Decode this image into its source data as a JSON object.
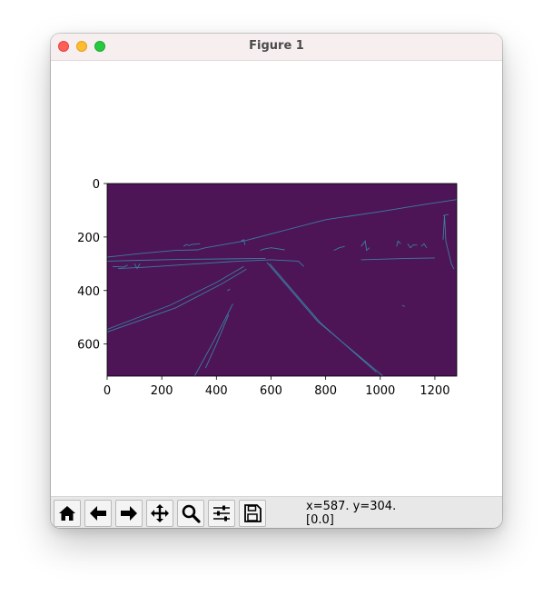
{
  "window": {
    "title": "Figure 1"
  },
  "toolbar": {
    "buttons": [
      {
        "name": "home",
        "icon": "home-icon"
      },
      {
        "name": "back",
        "icon": "arrow-left-icon"
      },
      {
        "name": "forward",
        "icon": "arrow-right-icon"
      },
      {
        "name": "pan",
        "icon": "move-icon"
      },
      {
        "name": "zoom",
        "icon": "magnifier-icon"
      },
      {
        "name": "configure-subplots",
        "icon": "sliders-icon"
      },
      {
        "name": "save",
        "icon": "floppy-disk-icon"
      }
    ],
    "coord_readout": "x=587. y=304.",
    "pixel_value": "[0.0]"
  },
  "chart_data": {
    "type": "heatmap",
    "title": "",
    "xlabel": "",
    "ylabel": "",
    "xlim": [
      0,
      1280
    ],
    "ylim": [
      720,
      0
    ],
    "x_ticks": [
      "0",
      "200",
      "400",
      "600",
      "800",
      "1000",
      "1200"
    ],
    "y_ticks": [
      "0",
      "200",
      "400",
      "600"
    ],
    "x_tick_values": [
      0,
      200,
      400,
      600,
      800,
      1000,
      1200
    ],
    "y_tick_values": [
      0,
      200,
      400,
      600
    ],
    "colors": {
      "background": "#440154",
      "edges": "#3b7ea1",
      "frame": "#000000"
    },
    "edge_polylines": [
      [
        [
          0,
          555
        ],
        [
          250,
          465
        ],
        [
          420,
          375
        ],
        [
          510,
          320
        ]
      ],
      [
        [
          0,
          545
        ],
        [
          230,
          455
        ],
        [
          400,
          370
        ],
        [
          500,
          310
        ]
      ],
      [
        [
          595,
          300
        ],
        [
          780,
          520
        ],
        [
          985,
          705
        ]
      ],
      [
        [
          585,
          295
        ],
        [
          770,
          515
        ],
        [
          1010,
          720
        ]
      ],
      [
        [
          320,
          720
        ],
        [
          390,
          590
        ],
        [
          460,
          450
        ]
      ],
      [
        [
          360,
          690
        ],
        [
          400,
          600
        ],
        [
          445,
          490
        ]
      ],
      [
        [
          0,
          275
        ],
        [
          120,
          262
        ],
        [
          250,
          250
        ],
        [
          330,
          248
        ],
        [
          360,
          240
        ]
      ],
      [
        [
          360,
          240
        ],
        [
          500,
          215
        ],
        [
          650,
          175
        ],
        [
          800,
          135
        ],
        [
          1000,
          105
        ],
        [
          1150,
          80
        ],
        [
          1280,
          60
        ]
      ],
      [
        [
          40,
          318
        ],
        [
          150,
          312
        ],
        [
          300,
          302
        ],
        [
          450,
          292
        ],
        [
          600,
          285
        ]
      ],
      [
        [
          0,
          290
        ],
        [
          120,
          287
        ],
        [
          260,
          284
        ],
        [
          420,
          282
        ],
        [
          580,
          280
        ]
      ],
      [
        [
          600,
          285
        ],
        [
          700,
          290
        ],
        [
          720,
          310
        ]
      ],
      [
        [
          20,
          310
        ],
        [
          60,
          312
        ],
        [
          75,
          305
        ]
      ],
      [
        [
          100,
          300
        ],
        [
          110,
          318
        ],
        [
          120,
          300
        ]
      ],
      [
        [
          280,
          235
        ],
        [
          290,
          228
        ],
        [
          300,
          232
        ],
        [
          310,
          228
        ],
        [
          340,
          225
        ]
      ],
      [
        [
          490,
          215
        ],
        [
          500,
          210
        ],
        [
          505,
          230
        ]
      ],
      [
        [
          560,
          250
        ],
        [
          575,
          245
        ],
        [
          600,
          240
        ],
        [
          650,
          248
        ]
      ],
      [
        [
          830,
          250
        ],
        [
          850,
          240
        ],
        [
          870,
          235
        ]
      ],
      [
        [
          930,
          235
        ],
        [
          945,
          215
        ],
        [
          950,
          250
        ],
        [
          960,
          240
        ]
      ],
      [
        [
          1060,
          235
        ],
        [
          1065,
          215
        ],
        [
          1075,
          225
        ]
      ],
      [
        [
          1100,
          225
        ],
        [
          1110,
          240
        ],
        [
          1120,
          230
        ],
        [
          1135,
          230
        ]
      ],
      [
        [
          1150,
          235
        ],
        [
          1160,
          225
        ],
        [
          1170,
          240
        ]
      ],
      [
        [
          1230,
          210
        ],
        [
          1235,
          120
        ],
        [
          1240,
          215
        ],
        [
          1260,
          300
        ],
        [
          1270,
          320
        ]
      ],
      [
        [
          1230,
          120
        ],
        [
          1250,
          115
        ]
      ],
      [
        [
          930,
          285
        ],
        [
          1100,
          280
        ],
        [
          1200,
          278
        ]
      ],
      [
        [
          440,
          400
        ],
        [
          450,
          395
        ]
      ],
      [
        [
          1080,
          455
        ],
        [
          1090,
          460
        ]
      ]
    ]
  }
}
